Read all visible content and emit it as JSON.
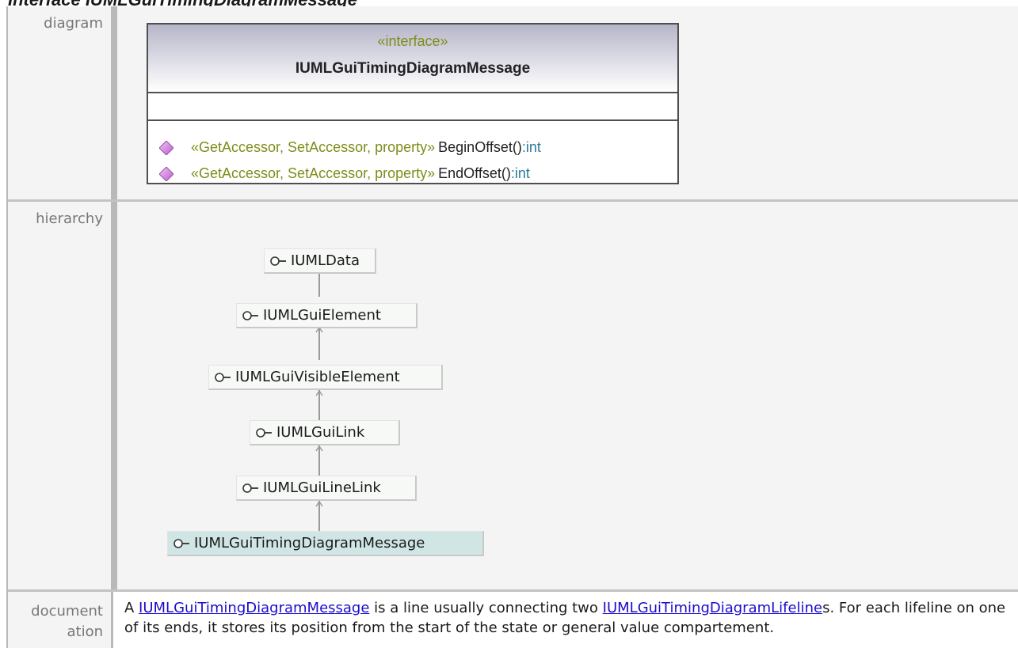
{
  "page": {
    "title": "Interface IUMLGuiTimingDiagramMessage"
  },
  "rows": {
    "diagram_label": "diagram",
    "hierarchy_label": "hierarchy",
    "documentation_label_line1": "document",
    "documentation_label_line2": "ation"
  },
  "uml_class": {
    "stereotype": "«interface»",
    "name": "IUMLGuiTimingDiagramMessage",
    "operations": [
      {
        "stereotype": "«GetAccessor, SetAccessor, property»",
        "name": "BeginOffset()",
        "type": ":int",
        "icon": "operation-diamond-icon"
      },
      {
        "stereotype": "«GetAccessor, SetAccessor, property»",
        "name": "EndOffset()",
        "type": ":int",
        "icon": "operation-diamond-icon"
      }
    ]
  },
  "hierarchy": [
    {
      "name": "IUMLData",
      "current": false
    },
    {
      "name": "IUMLGuiElement",
      "current": false
    },
    {
      "name": "IUMLGuiVisibleElement",
      "current": false
    },
    {
      "name": "IUMLGuiLink",
      "current": false
    },
    {
      "name": "IUMLGuiLineLink",
      "current": false
    },
    {
      "name": "IUMLGuiTimingDiagramMessage",
      "current": true
    }
  ],
  "documentation": {
    "t1": "A ",
    "link1": "IUMLGuiTimingDiagramMessage",
    "t2": " is a line usually connecting two ",
    "link2": "IUMLGuiTimingDiagramLifeline",
    "t3": "s. For each lifeline on one of its ends, it stores its position from the start of the state or general value compartement."
  },
  "colors": {
    "stereotype": "#7f8c1a",
    "type": "#2d7a9a",
    "operation_icon": "#c978d8",
    "current_node": "#d0e6e5",
    "link": "#1a0dcc"
  }
}
